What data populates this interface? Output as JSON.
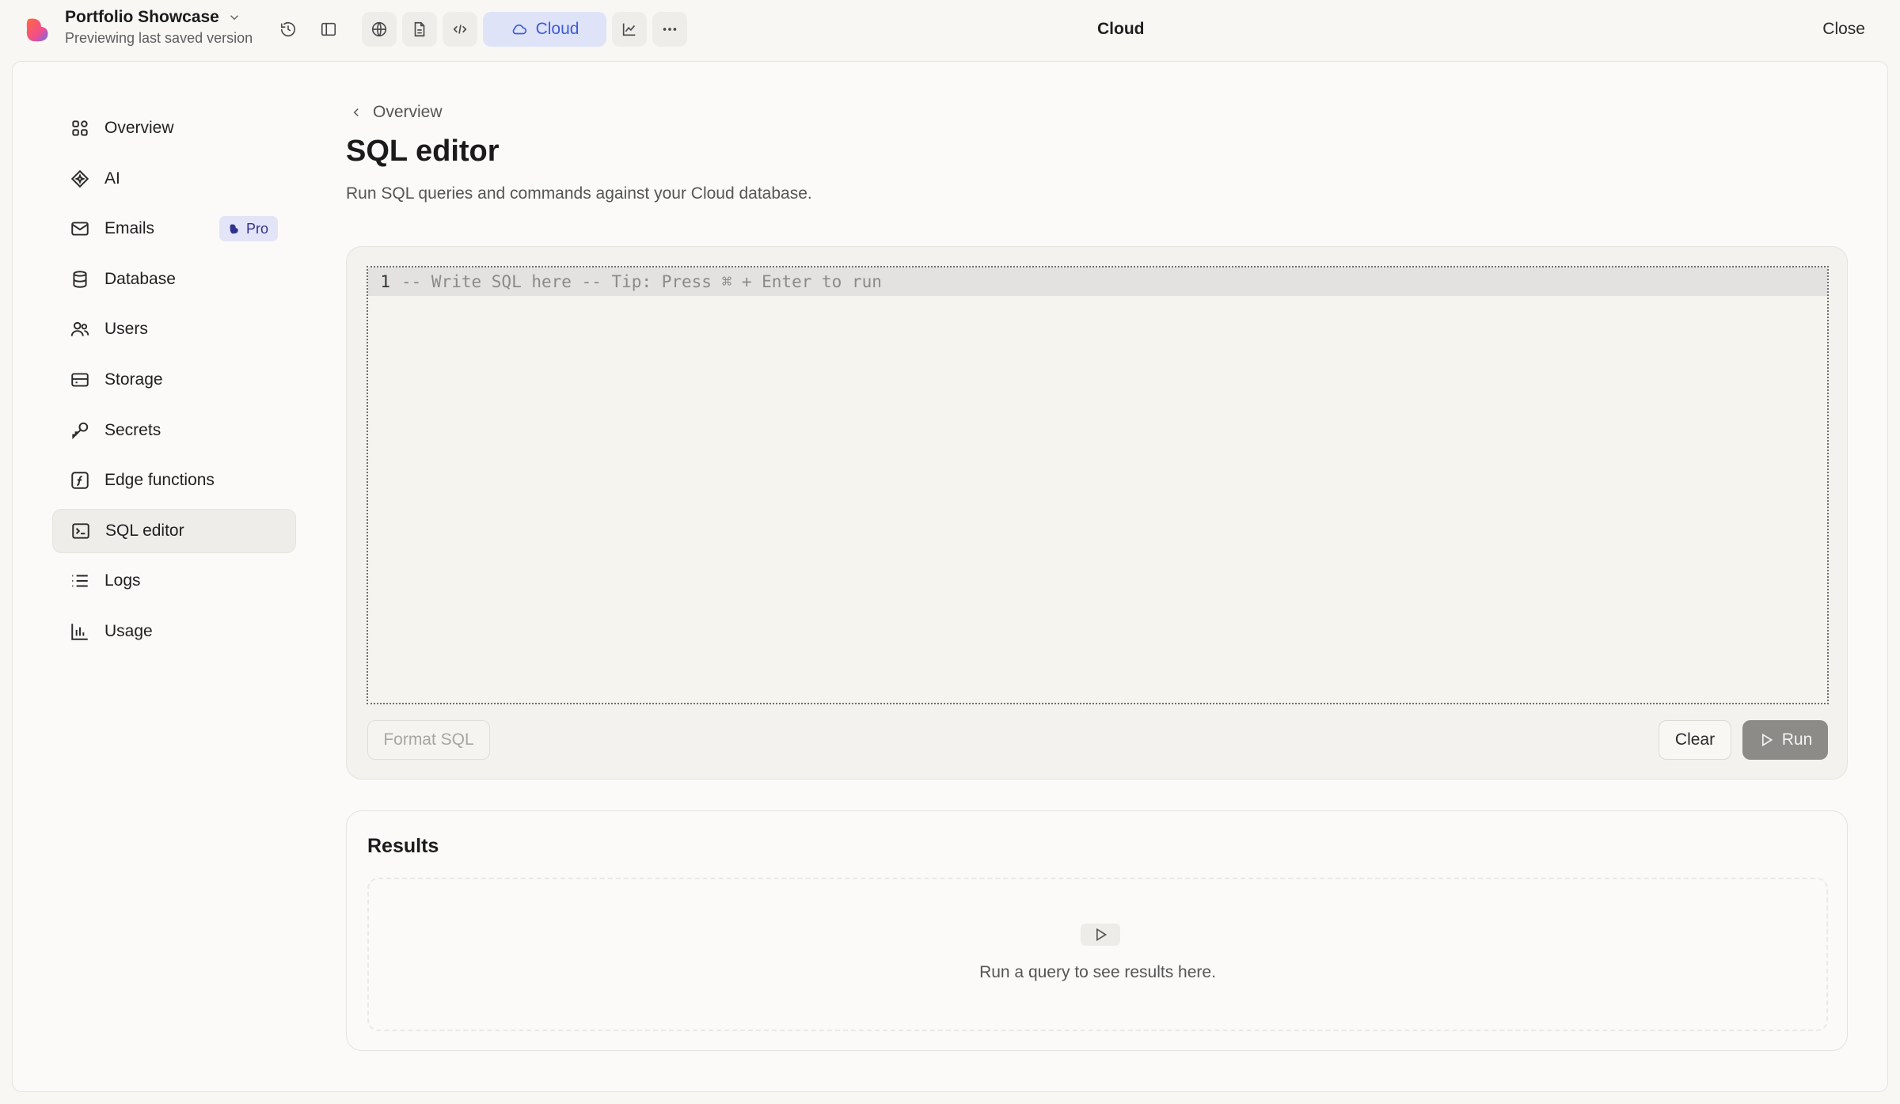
{
  "topbar": {
    "project_name": "Portfolio Showcase",
    "project_subtitle": "Previewing last saved version",
    "cloud_pill_label": "Cloud",
    "title": "Cloud",
    "close_label": "Close",
    "icons": [
      "history-icon",
      "sidebar-toggle-icon",
      "globe-icon",
      "document-icon",
      "code-icon",
      "cloud-icon",
      "chart-icon",
      "more-icon"
    ]
  },
  "sidebar": {
    "items": [
      {
        "label": "Overview",
        "icon": "grid-icon"
      },
      {
        "label": "AI",
        "icon": "ai-sparkle-icon"
      },
      {
        "label": "Emails",
        "icon": "mail-icon",
        "badge": "Pro"
      },
      {
        "label": "Database",
        "icon": "database-icon"
      },
      {
        "label": "Users",
        "icon": "users-icon"
      },
      {
        "label": "Storage",
        "icon": "storage-icon"
      },
      {
        "label": "Secrets",
        "icon": "key-icon"
      },
      {
        "label": "Edge functions",
        "icon": "function-icon"
      },
      {
        "label": "SQL editor",
        "icon": "terminal-icon",
        "active": true
      },
      {
        "label": "Logs",
        "icon": "list-icon"
      },
      {
        "label": "Usage",
        "icon": "bar-chart-icon"
      }
    ]
  },
  "main": {
    "breadcrumb": "Overview",
    "title": "SQL editor",
    "description": "Run SQL queries and commands against your Cloud database.",
    "editor": {
      "line_number": "1",
      "placeholder": "-- Write SQL here -- Tip: Press ⌘ + Enter to run",
      "format_label": "Format SQL",
      "clear_label": "Clear",
      "run_label": "Run"
    },
    "results": {
      "title": "Results",
      "empty_text": "Run a query to see results here."
    }
  },
  "colors": {
    "accent": "#3d5bd6",
    "accent_bg": "#dfe3f8",
    "pro_badge_bg": "#e3e4f7",
    "run_button_bg": "#8c8b88"
  }
}
